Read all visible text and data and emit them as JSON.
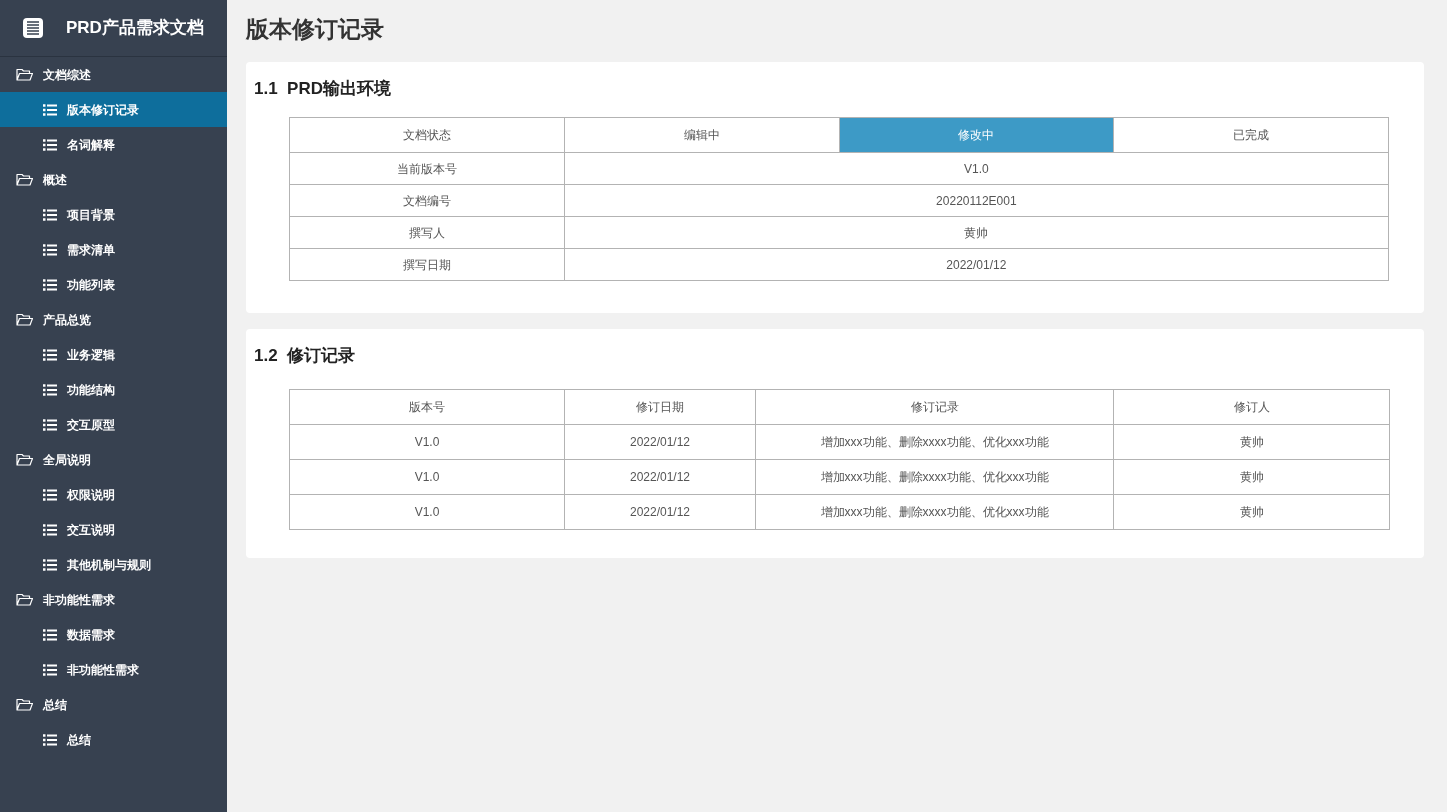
{
  "sidebar": {
    "title": "PRD产品需求文档",
    "groups": [
      {
        "label": "文档综述",
        "children": [
          {
            "label": "版本修订记录",
            "selected": true
          },
          {
            "label": "名词解释",
            "selected": false
          }
        ]
      },
      {
        "label": "概述",
        "children": [
          {
            "label": "项目背景",
            "selected": false
          },
          {
            "label": "需求清单",
            "selected": false
          },
          {
            "label": "功能列表",
            "selected": false
          }
        ]
      },
      {
        "label": "产品总览",
        "children": [
          {
            "label": "业务逻辑",
            "selected": false
          },
          {
            "label": "功能结构",
            "selected": false
          },
          {
            "label": "交互原型",
            "selected": false
          }
        ]
      },
      {
        "label": "全局说明",
        "children": [
          {
            "label": "权限说明",
            "selected": false
          },
          {
            "label": "交互说明",
            "selected": false
          },
          {
            "label": "其他机制与规则",
            "selected": false
          }
        ]
      },
      {
        "label": "非功能性需求",
        "children": [
          {
            "label": "数据需求",
            "selected": false
          },
          {
            "label": "非功能性需求",
            "selected": false
          }
        ]
      },
      {
        "label": "总结",
        "children": [
          {
            "label": "总结",
            "selected": false
          }
        ]
      }
    ]
  },
  "page_title": "版本修订记录",
  "env_section": {
    "number": "1.1",
    "title": "PRD输出环境",
    "status_label": "文档状态",
    "status_options": [
      {
        "label": "编辑中",
        "selected": false
      },
      {
        "label": "修改中",
        "selected": true
      },
      {
        "label": "已完成",
        "selected": false
      }
    ],
    "rows": [
      {
        "label": "当前版本号",
        "value": "V1.0"
      },
      {
        "label": "文档编号",
        "value": "20220112E001"
      },
      {
        "label": "撰写人",
        "value": "黄帅"
      },
      {
        "label": "撰写日期",
        "value": "2022/01/12"
      }
    ]
  },
  "revision_section": {
    "number": "1.2",
    "title": "修订记录",
    "columns": [
      "版本号",
      "修订日期",
      "修订记录",
      "修订人"
    ],
    "rows": [
      [
        "V1.0",
        "2022/01/12",
        "增加xxx功能、删除xxxx功能、优化xxx功能",
        "黄帅"
      ],
      [
        "V1.0",
        "2022/01/12",
        "增加xxx功能、删除xxxx功能、优化xxx功能",
        "黄帅"
      ],
      [
        "V1.0",
        "2022/01/12",
        "增加xxx功能、删除xxxx功能、优化xxx功能",
        "黄帅"
      ]
    ]
  }
}
